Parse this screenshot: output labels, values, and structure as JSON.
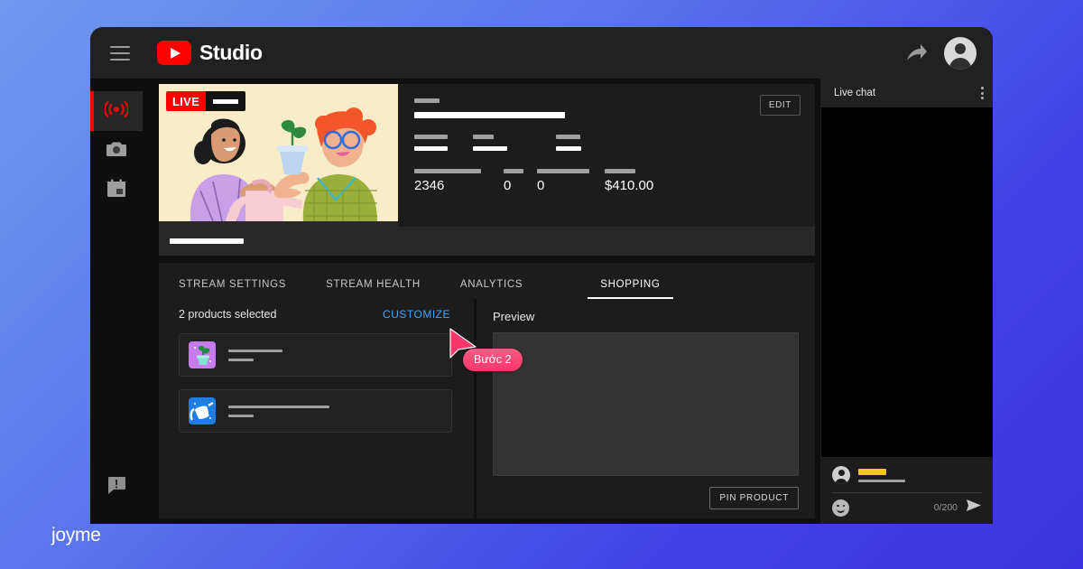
{
  "app": {
    "brand_name": "Studio",
    "logo_icon": "youtube-play-icon",
    "menu_icon": "hamburger-menu-icon",
    "share_icon": "share-arrow-icon",
    "account_icon": "account-avatar-icon"
  },
  "rail": {
    "items": [
      {
        "name": "go-live",
        "icon": "broadcast-live-icon",
        "active": true
      },
      {
        "name": "webcam",
        "icon": "camera-icon",
        "active": false
      },
      {
        "name": "schedule",
        "icon": "calendar-icon",
        "active": false
      }
    ],
    "bottom_item": {
      "name": "send-feedback",
      "icon": "feedback-icon"
    }
  },
  "stream": {
    "live_badge": "LIVE",
    "edit_label": "EDIT",
    "thumbnail_alt": "two-people-illustration-plant-watering-can",
    "stats": [
      {
        "label_redacted": true,
        "value": "2346"
      },
      {
        "label_redacted": true,
        "value": "0"
      },
      {
        "label_redacted": true,
        "value": "0"
      },
      {
        "label_redacted": true,
        "value": "$410.00"
      }
    ]
  },
  "tabs": [
    {
      "label": "STREAM SETTINGS",
      "active": false
    },
    {
      "label": "STREAM HEALTH",
      "active": false
    },
    {
      "label": "ANALYTICS",
      "active": false
    },
    {
      "label": "SHOPPING",
      "active": true
    }
  ],
  "shopping": {
    "selected_text": "2 products selected",
    "customize_label": "CUSTOMIZE",
    "customize_color": "#3ea6ff",
    "products": [
      {
        "icon": "potted-plant-icon",
        "tile_color": "#c77bec"
      },
      {
        "icon": "watering-can-icon",
        "tile_color": "#1f7de0"
      }
    ],
    "preview_label": "Preview",
    "pin_label": "PIN PRODUCT"
  },
  "chat": {
    "title": "Live chat",
    "menu_icon": "kebab-menu-icon",
    "user_icon": "account-avatar-icon",
    "emoji_icon": "emoji-smiley-icon",
    "send_icon": "send-arrow-icon",
    "counter": "0/200",
    "name_color": "#f5c518"
  },
  "annotation": {
    "step_label": "Bước 2",
    "cursor_icon": "mouse-cursor-icon",
    "accent_color": "#f5376c"
  },
  "watermark": {
    "text": "joyme"
  }
}
